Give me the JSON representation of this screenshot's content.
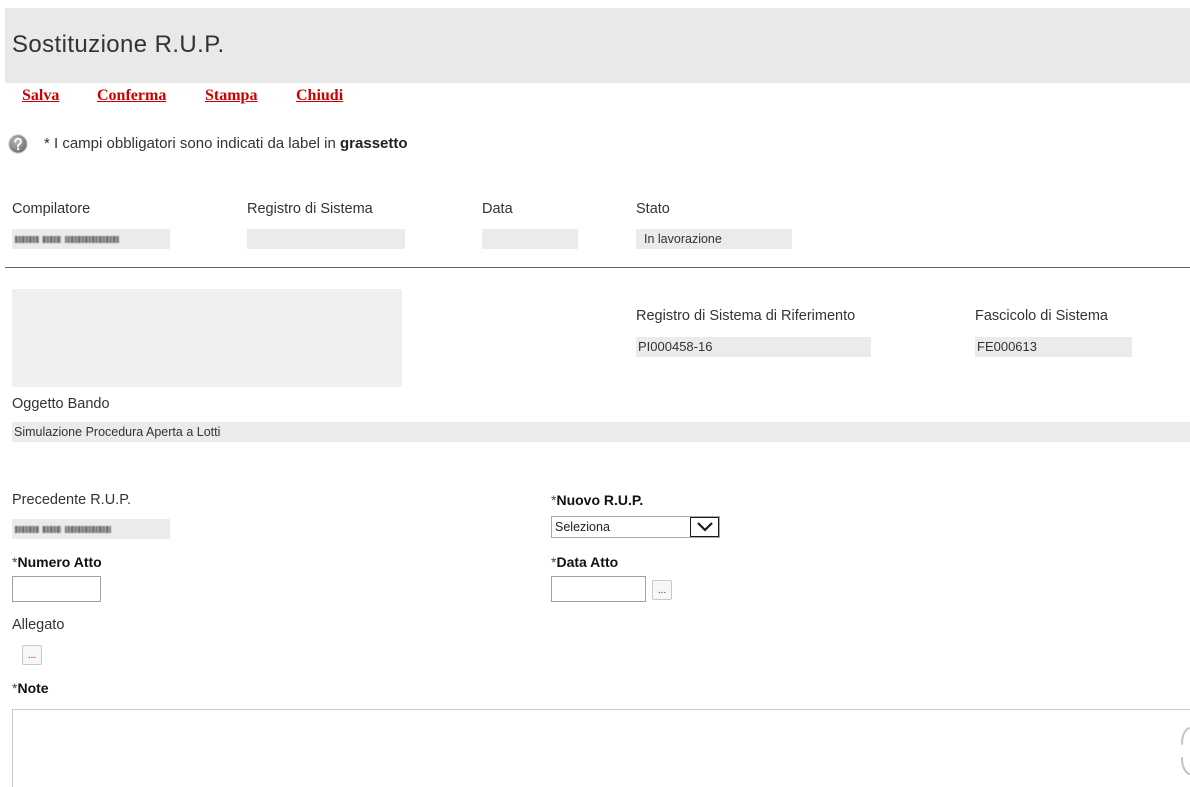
{
  "page": {
    "title": "Sostituzione R.U.P."
  },
  "toolbar": {
    "items": [
      {
        "label": "Salva"
      },
      {
        "label": "Conferma"
      },
      {
        "label": "Stampa"
      },
      {
        "label": "Chiudi"
      }
    ]
  },
  "help": {
    "icon": "help-icon",
    "text": "* I campi obbligatori sono indicati da label in ",
    "text_bold": "grassetto"
  },
  "header_fields": {
    "compilatore": {
      "label": "Compilatore"
    },
    "registro": {
      "label": "Registro di Sistema",
      "value": ""
    },
    "data": {
      "label": "Data",
      "value": ""
    },
    "stato": {
      "label": "Stato",
      "value": "In lavorazione"
    }
  },
  "reference": {
    "registro_riferimento": {
      "label": "Registro di Sistema di Riferimento",
      "value": "PI000458-16"
    },
    "fascicolo": {
      "label": "Fascicolo di Sistema",
      "value": "FE000613"
    }
  },
  "oggetto_bando": {
    "label": "Oggetto Bando",
    "value": "Simulazione Procedura Aperta a Lotti"
  },
  "form": {
    "required_mark": "*",
    "precedente_rup": {
      "label": "Precedente R.U.P."
    },
    "nuovo_rup": {
      "label": "Nuovo R.U.P.",
      "selected": "Seleziona",
      "icon": "chevron-down-icon"
    },
    "numero_atto": {
      "label": "Numero Atto",
      "value": ""
    },
    "data_atto": {
      "label": "Data Atto",
      "value": "",
      "picker_label": "..."
    },
    "allegato": {
      "label": "Allegato",
      "button_label": "..."
    },
    "note": {
      "label": "Note",
      "value": ""
    }
  },
  "colors": {
    "link": "#cc0000",
    "header_bg": "#e9e9e9",
    "field_bg": "#ebebeb",
    "text": "#333333"
  }
}
